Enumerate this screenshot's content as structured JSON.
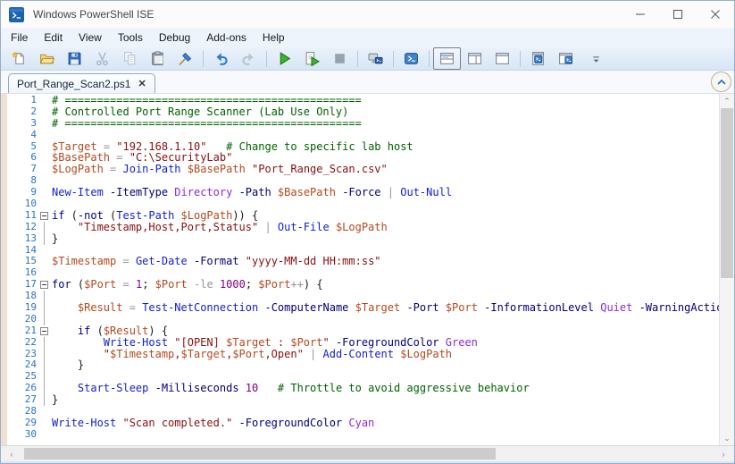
{
  "window": {
    "title": "Windows PowerShell ISE",
    "controls": [
      {
        "name": "minimize-button",
        "icon": "minimize-icon"
      },
      {
        "name": "maximize-button",
        "icon": "maximize-icon"
      },
      {
        "name": "close-button",
        "icon": "close-icon"
      }
    ]
  },
  "menu": {
    "items": [
      "File",
      "Edit",
      "View",
      "Tools",
      "Debug",
      "Add-ons",
      "Help"
    ]
  },
  "toolbar": {
    "groups": [
      {
        "items": [
          {
            "icon": "new-script-icon",
            "name": "new-script-button",
            "disabled": false,
            "selected": false
          },
          {
            "icon": "open-script-icon",
            "name": "open-script-button",
            "disabled": false,
            "selected": false
          },
          {
            "icon": "save-icon",
            "name": "save-button",
            "disabled": false,
            "selected": false
          },
          {
            "icon": "cut-icon",
            "name": "cut-button",
            "disabled": true,
            "selected": false
          },
          {
            "icon": "copy-icon",
            "name": "copy-button",
            "disabled": true,
            "selected": false
          },
          {
            "icon": "paste-icon",
            "name": "paste-button",
            "disabled": false,
            "selected": false
          },
          {
            "icon": "clear-console-icon",
            "name": "clear-console-button",
            "disabled": false,
            "selected": false
          }
        ]
      },
      {
        "items": [
          {
            "icon": "undo-icon",
            "name": "undo-button",
            "disabled": false,
            "selected": false
          },
          {
            "icon": "redo-icon",
            "name": "redo-button",
            "disabled": true,
            "selected": false
          }
        ]
      },
      {
        "items": [
          {
            "icon": "run-script-icon",
            "name": "run-script-button",
            "disabled": false,
            "selected": false
          },
          {
            "icon": "run-selection-icon",
            "name": "run-selection-button",
            "disabled": false,
            "selected": false
          },
          {
            "icon": "stop-icon",
            "name": "stop-operation-button",
            "disabled": true,
            "selected": false
          }
        ]
      },
      {
        "items": [
          {
            "icon": "new-remote-powershell-tab-icon",
            "name": "new-remote-powershell-tab-button",
            "disabled": false,
            "selected": false
          }
        ]
      },
      {
        "items": [
          {
            "icon": "start-powershell-icon",
            "name": "start-powershell-button",
            "disabled": false,
            "selected": false
          }
        ]
      },
      {
        "items": [
          {
            "icon": "script-pane-top-icon",
            "name": "show-script-pane-top-button",
            "disabled": false,
            "selected": true
          },
          {
            "icon": "script-pane-right-icon",
            "name": "show-script-pane-right-button",
            "disabled": false,
            "selected": false
          },
          {
            "icon": "script-pane-maximized-icon",
            "name": "show-script-pane-maximized-button",
            "disabled": false,
            "selected": false
          }
        ]
      },
      {
        "items": [
          {
            "icon": "show-script-pane-icon",
            "name": "toggle-script-pane-button",
            "disabled": false,
            "selected": false
          },
          {
            "icon": "show-command-window-icon",
            "name": "show-command-window-button",
            "disabled": false,
            "selected": false
          }
        ]
      }
    ],
    "overflow": {
      "icon": "toolbar-overflow-icon",
      "name": "toolbar-overflow-button"
    }
  },
  "tabs": {
    "active": {
      "label": "Port_Range_Scan2.ps1",
      "close_glyph": "✕"
    }
  },
  "editor": {
    "lines": [
      {
        "n": "1",
        "g": "",
        "t": [
          [
            "c",
            "# =============================================="
          ]
        ]
      },
      {
        "n": "2",
        "g": "",
        "t": [
          [
            "c",
            "# Controlled Port Range Scanner (Lab Use Only)"
          ]
        ]
      },
      {
        "n": "3",
        "g": "",
        "t": [
          [
            "c",
            "# =============================================="
          ]
        ]
      },
      {
        "n": "4",
        "g": "",
        "t": []
      },
      {
        "n": "5",
        "g": "",
        "t": [
          [
            "v",
            "$Target"
          ],
          [
            "t",
            " "
          ],
          [
            "o",
            "="
          ],
          [
            "t",
            " "
          ],
          [
            "s",
            "\"192.168.1.10\""
          ],
          [
            "t",
            "   "
          ],
          [
            "c",
            "# Change to specific lab host"
          ]
        ]
      },
      {
        "n": "6",
        "g": "",
        "t": [
          [
            "v",
            "$BasePath"
          ],
          [
            "t",
            " "
          ],
          [
            "o",
            "="
          ],
          [
            "t",
            " "
          ],
          [
            "s",
            "\"C:\\SecurityLab\""
          ]
        ]
      },
      {
        "n": "7",
        "g": "",
        "t": [
          [
            "v",
            "$LogPath"
          ],
          [
            "t",
            " "
          ],
          [
            "o",
            "="
          ],
          [
            "t",
            " "
          ],
          [
            "cmd",
            "Join-Path"
          ],
          [
            "t",
            " "
          ],
          [
            "v",
            "$BasePath"
          ],
          [
            "t",
            " "
          ],
          [
            "s",
            "\"Port_Range_Scan.csv\""
          ]
        ]
      },
      {
        "n": "8",
        "g": "",
        "t": []
      },
      {
        "n": "9",
        "g": "",
        "t": [
          [
            "cmd",
            "New-Item"
          ],
          [
            "t",
            " "
          ],
          [
            "p",
            "-ItemType"
          ],
          [
            "t",
            " "
          ],
          [
            "a",
            "Directory"
          ],
          [
            "t",
            " "
          ],
          [
            "p",
            "-Path"
          ],
          [
            "t",
            " "
          ],
          [
            "v",
            "$BasePath"
          ],
          [
            "t",
            " "
          ],
          [
            "p",
            "-Force"
          ],
          [
            "t",
            " "
          ],
          [
            "o",
            "|"
          ],
          [
            "t",
            " "
          ],
          [
            "cmd",
            "Out-Null"
          ]
        ]
      },
      {
        "n": "10",
        "g": "",
        "t": []
      },
      {
        "n": "11",
        "g": "box",
        "t": [
          [
            "k",
            "if"
          ],
          [
            "t",
            " ("
          ],
          [
            "p",
            "-not"
          ],
          [
            "t",
            " ("
          ],
          [
            "cmd",
            "Test-Path"
          ],
          [
            "t",
            " "
          ],
          [
            "v",
            "$LogPath"
          ],
          [
            "t",
            ")) {"
          ]
        ]
      },
      {
        "n": "12",
        "g": "line",
        "t": [
          [
            "t",
            "    "
          ],
          [
            "s",
            "\"Timestamp,Host,Port,Status\""
          ],
          [
            "t",
            " "
          ],
          [
            "o",
            "|"
          ],
          [
            "t",
            " "
          ],
          [
            "cmd",
            "Out-File"
          ],
          [
            "t",
            " "
          ],
          [
            "v",
            "$LogPath"
          ]
        ]
      },
      {
        "n": "13",
        "g": "line",
        "t": [
          [
            "t",
            "}"
          ]
        ]
      },
      {
        "n": "14",
        "g": "",
        "t": []
      },
      {
        "n": "15",
        "g": "",
        "t": [
          [
            "v",
            "$Timestamp"
          ],
          [
            "t",
            " "
          ],
          [
            "o",
            "="
          ],
          [
            "t",
            " "
          ],
          [
            "cmd",
            "Get-Date"
          ],
          [
            "t",
            " "
          ],
          [
            "p",
            "-Format"
          ],
          [
            "t",
            " "
          ],
          [
            "s",
            "\"yyyy-MM-dd HH:mm:ss\""
          ]
        ]
      },
      {
        "n": "16",
        "g": "",
        "t": []
      },
      {
        "n": "17",
        "g": "box",
        "t": [
          [
            "k",
            "for"
          ],
          [
            "t",
            " ("
          ],
          [
            "v",
            "$Port"
          ],
          [
            "t",
            " "
          ],
          [
            "o",
            "="
          ],
          [
            "t",
            " "
          ],
          [
            "n2",
            "1"
          ],
          [
            "t",
            "; "
          ],
          [
            "v",
            "$Port"
          ],
          [
            "t",
            " "
          ],
          [
            "o",
            "-le"
          ],
          [
            "t",
            " "
          ],
          [
            "n2",
            "1000"
          ],
          [
            "t",
            "; "
          ],
          [
            "v",
            "$Port"
          ],
          [
            "o",
            "++"
          ],
          [
            "t",
            ") {"
          ]
        ]
      },
      {
        "n": "18",
        "g": "line",
        "t": []
      },
      {
        "n": "19",
        "g": "line",
        "t": [
          [
            "t",
            "    "
          ],
          [
            "v",
            "$Result"
          ],
          [
            "t",
            " "
          ],
          [
            "o",
            "="
          ],
          [
            "t",
            " "
          ],
          [
            "cmd",
            "Test-NetConnection"
          ],
          [
            "t",
            " "
          ],
          [
            "p",
            "-ComputerName"
          ],
          [
            "t",
            " "
          ],
          [
            "v",
            "$Target"
          ],
          [
            "t",
            " "
          ],
          [
            "p",
            "-Port"
          ],
          [
            "t",
            " "
          ],
          [
            "v",
            "$Port"
          ],
          [
            "t",
            " "
          ],
          [
            "p",
            "-InformationLevel"
          ],
          [
            "t",
            " "
          ],
          [
            "a",
            "Quiet"
          ],
          [
            "t",
            " "
          ],
          [
            "p",
            "-WarningActio"
          ]
        ]
      },
      {
        "n": "20",
        "g": "line",
        "t": []
      },
      {
        "n": "21",
        "g": "box",
        "t": [
          [
            "t",
            "    "
          ],
          [
            "k",
            "if"
          ],
          [
            "t",
            " ("
          ],
          [
            "v",
            "$Result"
          ],
          [
            "t",
            ") {"
          ]
        ]
      },
      {
        "n": "22",
        "g": "line",
        "t": [
          [
            "t",
            "        "
          ],
          [
            "cmd",
            "Write-Host"
          ],
          [
            "t",
            " "
          ],
          [
            "s",
            "\"[OPEN] "
          ],
          [
            "v",
            "$Target"
          ],
          [
            "s",
            " : "
          ],
          [
            "v",
            "$Port"
          ],
          [
            "s",
            "\""
          ],
          [
            "t",
            " "
          ],
          [
            "p",
            "-ForegroundColor"
          ],
          [
            "t",
            " "
          ],
          [
            "a",
            "Green"
          ]
        ]
      },
      {
        "n": "23",
        "g": "line",
        "t": [
          [
            "t",
            "        "
          ],
          [
            "s",
            "\""
          ],
          [
            "v",
            "$Timestamp"
          ],
          [
            "s",
            ","
          ],
          [
            "v",
            "$Target"
          ],
          [
            "s",
            ","
          ],
          [
            "v",
            "$Port"
          ],
          [
            "s",
            ",Open\""
          ],
          [
            "t",
            " "
          ],
          [
            "o",
            "|"
          ],
          [
            "t",
            " "
          ],
          [
            "cmd",
            "Add-Content"
          ],
          [
            "t",
            " "
          ],
          [
            "v",
            "$LogPath"
          ]
        ]
      },
      {
        "n": "24",
        "g": "line",
        "t": [
          [
            "t",
            "    }"
          ]
        ]
      },
      {
        "n": "25",
        "g": "line",
        "t": []
      },
      {
        "n": "26",
        "g": "line",
        "t": [
          [
            "t",
            "    "
          ],
          [
            "cmd",
            "Start-Sleep"
          ],
          [
            "t",
            " "
          ],
          [
            "p",
            "-Milliseconds"
          ],
          [
            "t",
            " "
          ],
          [
            "n2",
            "10"
          ],
          [
            "t",
            "   "
          ],
          [
            "c",
            "# Throttle to avoid aggressive behavior"
          ]
        ]
      },
      {
        "n": "27",
        "g": "line",
        "t": [
          [
            "t",
            "}"
          ]
        ]
      },
      {
        "n": "28",
        "g": "",
        "t": []
      },
      {
        "n": "29",
        "g": "",
        "t": [
          [
            "cmd",
            "Write-Host"
          ],
          [
            "t",
            " "
          ],
          [
            "s",
            "\"Scan completed.\""
          ],
          [
            "t",
            " "
          ],
          [
            "p",
            "-ForegroundColor"
          ],
          [
            "t",
            " "
          ],
          [
            "a",
            "Cyan"
          ]
        ]
      },
      {
        "n": "30",
        "g": "",
        "t": []
      }
    ],
    "colors": {
      "comment": "#006400",
      "string": "#8b0f0f",
      "variable": "#b5491f",
      "command": "#0f1fd6",
      "parameter": "#000080",
      "keyword": "#00008b",
      "argument": "#8a2be2",
      "number": "#800080",
      "operator": "#969696",
      "line_number": "#2873c8",
      "margin_strip": "#f2dfd4"
    }
  },
  "scrollbars": {
    "vertical": {
      "up_glyph": "⌃",
      "down_glyph": "⌄"
    },
    "horizontal": {
      "left_glyph": "‹",
      "right_glyph": "›"
    }
  }
}
